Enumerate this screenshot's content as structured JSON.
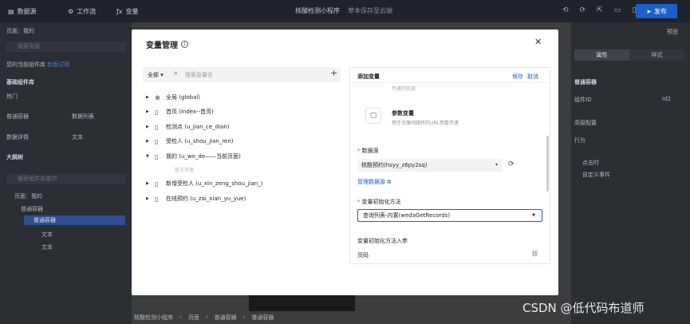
{
  "topbar": {
    "tab_pages": "数据源",
    "tab_workflow": "工作流",
    "tab_vars": "变量",
    "app_name": "核酸检测小程序",
    "save_status": "草本保存至云端",
    "publish": "发布"
  },
  "left_sidebar": {
    "page_label": "页面：我的",
    "search_placeholder": "搜索页面",
    "notice": "您的当前组件库",
    "notice_link": "新版试用",
    "components_title": "基础组件库",
    "hot_label": "热门",
    "comp_1": "普通容器",
    "comp_2": "数据列表",
    "comp_3": "数据详情",
    "comp_4": "文本",
    "outline_title": "大纲树",
    "outline_search": "搜索组件名或ID",
    "tree_page": "页面：我的",
    "tree_container": "普通容器",
    "tree_selected": "普通容器",
    "tree_text_1": "文本",
    "tree_text_2": "文本"
  },
  "right_sidebar": {
    "top_right": "预览",
    "tab_attr": "属性",
    "tab_style": "样式",
    "comp_name": "普通容器",
    "comp_id_label": "组件ID",
    "comp_id_value": "id2",
    "advanced": "高级配置",
    "behavior": "行为",
    "event_1": "点击时",
    "event_2": "自定义事件"
  },
  "bottom_crumb": {
    "c1": "核酸检测小程序",
    "c2": "页面",
    "c3": "普通容器",
    "c4": "普通容器"
  },
  "modal": {
    "title": "变量管理",
    "left": {
      "scope": "全部",
      "search_placeholder": "搜索变量名",
      "items": [
        {
          "label": "全局 (global)"
        },
        {
          "label": "首页 (index--首页)"
        },
        {
          "label": "检测点 (u_jian_ce_dian)"
        },
        {
          "label": "受检人 (u_shou_jian_ren)"
        },
        {
          "label": "我的 (u_wo_de——当前页面)"
        },
        {
          "label": "新增受检人 (u_xin_zeng_shou_jian_)"
        },
        {
          "label": "在线预约 (u_zai_xian_yu_yue)"
        }
      ],
      "empty_text": "暂无变量"
    },
    "right": {
      "title": "添加变量",
      "save": "保存",
      "cancel": "取消",
      "faint_text": "传递的信息",
      "param_var_title": "参数变量",
      "param_var_desc": "用于页面间跳转的URL参数传递",
      "datasource_label": "数据源",
      "datasource_value": "核酸预约(hsyy_z6py2sq)",
      "manage_link": "管理数据源",
      "init_method_label": "变量初始化方法",
      "init_method_value": "查询列表-内置(wedaGetRecords)",
      "init_params_label": "变量初始化方法入参",
      "param_page": "页码"
    }
  },
  "watermark": "CSDN @低代码布道师"
}
